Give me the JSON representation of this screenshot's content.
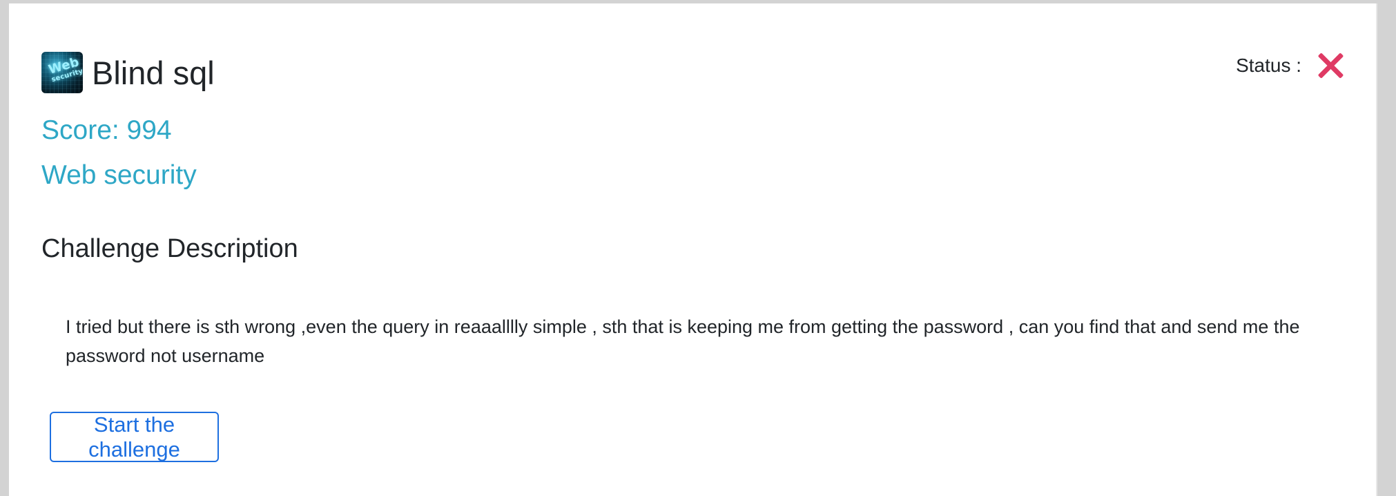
{
  "challenge": {
    "title": "Blind sql",
    "icon": "web-security-icon",
    "icon_text_line_1": "Web",
    "icon_text_line_2": "security",
    "status_label": "Status :",
    "status_icon": "close-icon",
    "score_text": "Score: 994",
    "category_text": "Web security",
    "section_title": "Challenge Description",
    "description": "I tried but there is sth wrong ,even the query in reaaalllly simple , sth that is keeping me from getting the password , can you find that and send me the password not username",
    "button_label": "Start the challenge",
    "colors": {
      "accent_blue": "#1d6fe0",
      "teal_text": "#2ea7c6",
      "status_red": "#df3a64",
      "background": "#d3d3d3",
      "card": "#ffffff",
      "text": "#212529"
    }
  }
}
